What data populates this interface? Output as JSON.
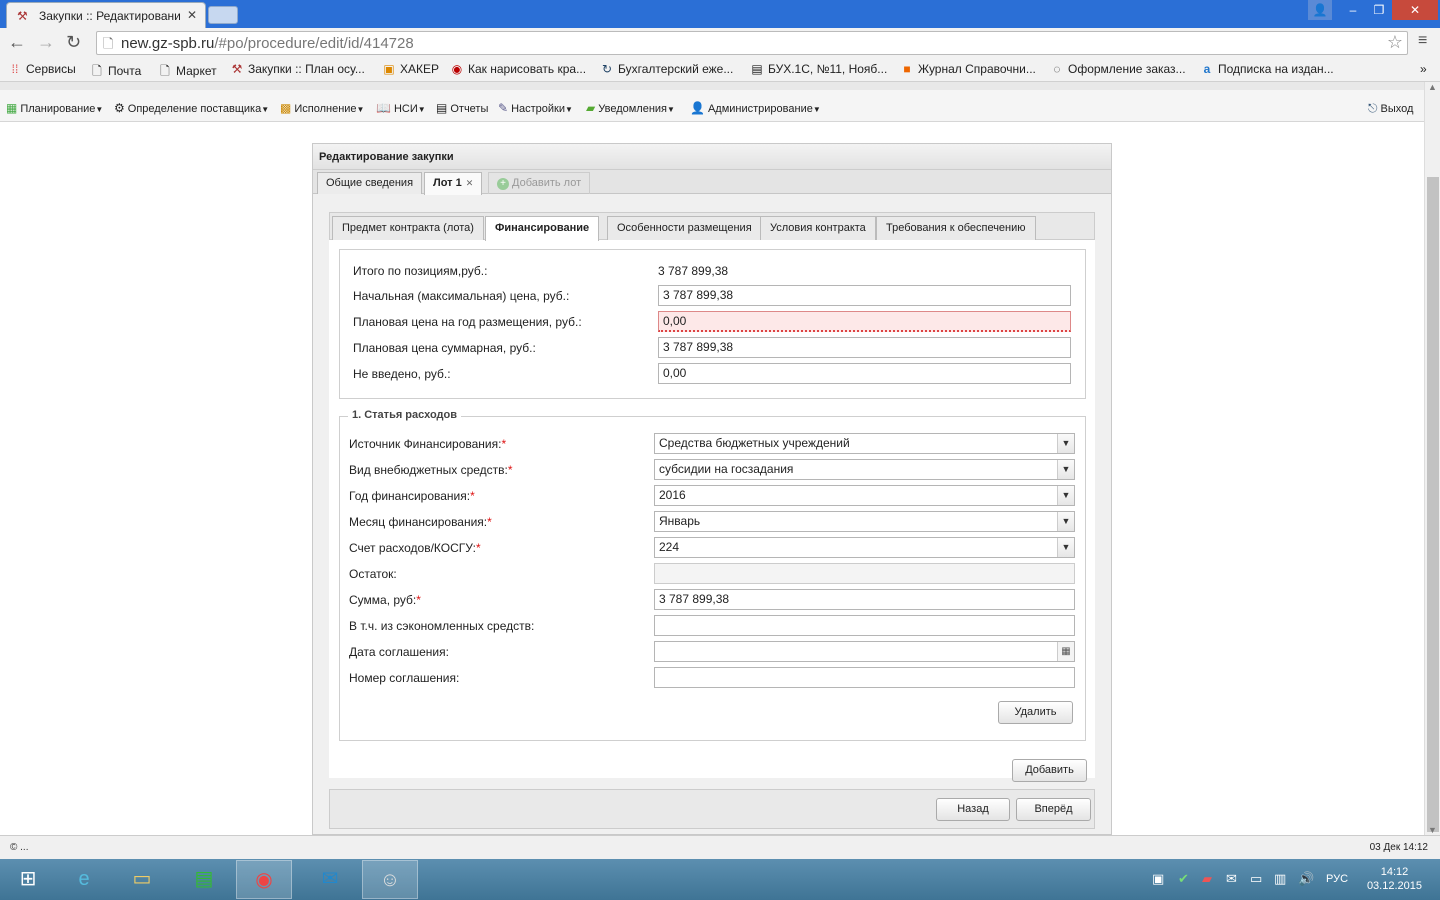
{
  "browser": {
    "tab_title": "Закупки :: Редактировани",
    "url_host": "new.gz-spb.ru",
    "url_path": "/#po/procedure/edit/id/414728",
    "bookmarks": [
      {
        "label": "Сервисы"
      },
      {
        "label": "Почта"
      },
      {
        "label": "Маркет"
      },
      {
        "label": "Закупки :: План осу..."
      },
      {
        "label": "ХАКЕР"
      },
      {
        "label": "Как нарисовать кра..."
      },
      {
        "label": "Бухгалтерский еже..."
      },
      {
        "label": "БУХ.1С, №11, Нояб..."
      },
      {
        "label": "Журнал Справочни..."
      },
      {
        "label": "Оформление заказ..."
      },
      {
        "label": "Подписка на издан..."
      }
    ]
  },
  "appmenu": {
    "items": [
      {
        "label": "Планирование"
      },
      {
        "label": "Определение поставщика"
      },
      {
        "label": "Исполнение"
      },
      {
        "label": "НСИ"
      },
      {
        "label": "Отчеты"
      },
      {
        "label": "Настройки"
      },
      {
        "label": "Уведомления"
      },
      {
        "label": "Администрирование"
      }
    ],
    "exit_label": "Выход"
  },
  "panel": {
    "title": "Редактирование закупки",
    "tabs": [
      {
        "label": "Общие сведения"
      },
      {
        "label": "Лот 1"
      },
      {
        "label": "Добавить лот"
      }
    ],
    "subtabs": [
      {
        "label": "Предмет контракта (лота)"
      },
      {
        "label": "Финансирование"
      },
      {
        "label": "Особенности размещения"
      },
      {
        "label": "Условия контракта"
      },
      {
        "label": "Требования к обеспечению"
      }
    ]
  },
  "totals": {
    "total_label": "Итого по позициям,руб.:",
    "total_value": "3 787 899,38",
    "nmc_label": "Начальная (максимальная) цена, руб.:",
    "nmc_value": "3 787 899,38",
    "plan_year_label": "Плановая цена на год размещения, руб.:",
    "plan_year_value": "0,00",
    "plan_sum_label": "Плановая цена суммарная, руб.:",
    "plan_sum_value": "3 787 899,38",
    "not_entered_label": "Не введено, руб.:",
    "not_entered_value": "0,00"
  },
  "expense": {
    "legend": "1. Статья расходов",
    "source_label": "Источник Финансирования:",
    "source_value": "Средства бюджетных учреждений",
    "kind_label": "Вид внебюджетных средств:",
    "kind_value": "субсидии на госзадания",
    "year_label": "Год финансирования:",
    "year_value": "2016",
    "month_label": "Месяц финансирования:",
    "month_value": "Январь",
    "account_label": "Счет расходов/КОСГУ:",
    "account_value": "224",
    "rest_label": "Остаток:",
    "rest_value": "",
    "sum_label": "Сумма, руб:",
    "sum_value": "3 787 899,38",
    "saved_label": "В т.ч. из сэкономленных средств:",
    "saved_value": "",
    "date_label": "Дата соглашения:",
    "date_value": "",
    "number_label": "Номер соглашения:",
    "number_value": "",
    "delete_label": "Удалить"
  },
  "actions": {
    "add_label": "Добавить",
    "back_label": "Назад",
    "next_label": "Вперёд"
  },
  "status": {
    "left": "© ...",
    "right": "03 Дек 14:12"
  },
  "taskbar": {
    "lang": "РУС",
    "time": "14:12",
    "date": "03.12.2015"
  },
  "colors": {
    "titlebar": "#2b6fd6",
    "required": "#dd1111",
    "error_bg": "#fde8e8"
  }
}
